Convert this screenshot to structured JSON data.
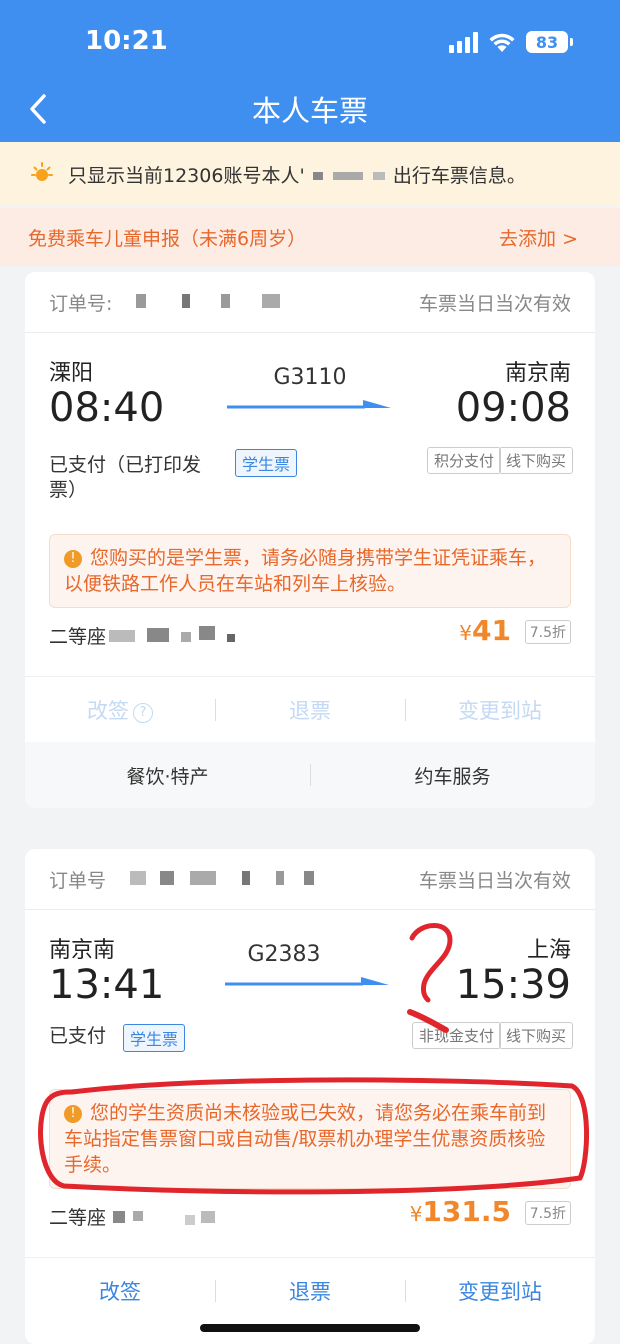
{
  "status_bar": {
    "time": "10:21",
    "battery": "83"
  },
  "nav": {
    "title": "本人车票"
  },
  "notice": {
    "prefix": "只显示当前12306账号本人'",
    "suffix": "出行车票信息。"
  },
  "child_report": {
    "label": "免费乘车儿童申报（未满6周岁）",
    "action": "去添加 >"
  },
  "tickets": [
    {
      "order_label": "订单号:",
      "validity": "车票当日当次有效",
      "from_station": "溧阳",
      "depart_time": "08:40",
      "train_no": "G3110",
      "to_station": "南京南",
      "arrive_time": "09:08",
      "pay_status": "已支付（已打印发票）",
      "student_tag": "学生票",
      "pay_method": "积分支付",
      "purchase_channel": "线下购买",
      "warning": "您购买的是学生票，请务必随身携带学生证凭证乘车，以便铁路工作人员在车站和列车上核验。",
      "seat": "二等座",
      "price_symbol": "¥",
      "price": "41",
      "discount": "7.5折",
      "actions": [
        "改签",
        "退票",
        "变更到站"
      ],
      "help_icon": "?",
      "services": [
        "餐饮·特产",
        "约车服务"
      ]
    },
    {
      "order_label": "订单号",
      "validity": "车票当日当次有效",
      "from_station": "南京南",
      "depart_time": "13:41",
      "train_no": "G2383",
      "to_station": "上海",
      "arrive_time": "15:39",
      "pay_status": "已支付",
      "student_tag": "学生票",
      "pay_method": "非现金支付",
      "purchase_channel": "线下购买",
      "warning": "您的学生资质尚未核验或已失效，请您务必在乘车前到车站指定售票窗口或自动售/取票机办理学生优惠资质核验手续。",
      "seat": "二等座",
      "price_symbol": "¥",
      "price": "131.5",
      "discount": "7.5折",
      "actions": [
        "改签",
        "退票",
        "变更到站"
      ]
    }
  ],
  "warning_icon": "!",
  "colors": {
    "header": "#3f8ff0",
    "accent_orange": "#e8672b",
    "link_blue": "#3a86e0",
    "annotation_red": "#e0262c"
  }
}
